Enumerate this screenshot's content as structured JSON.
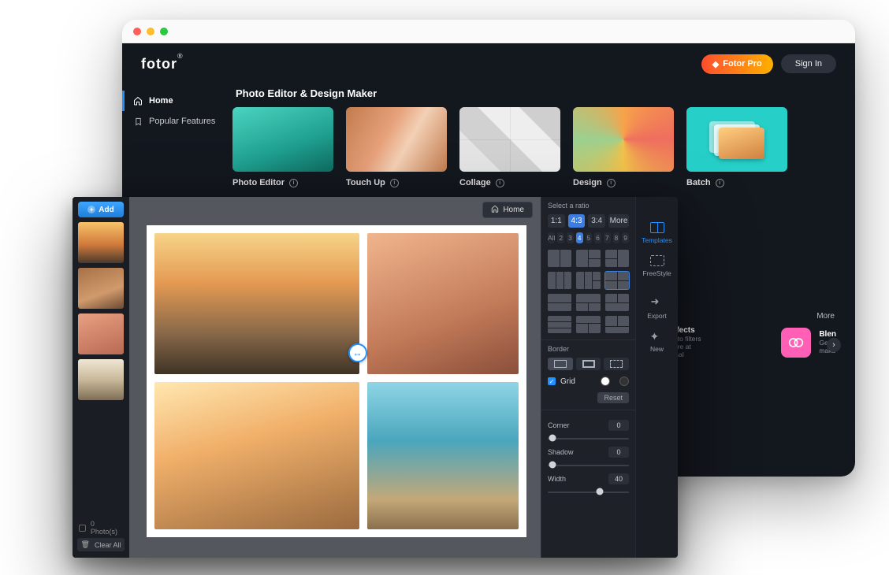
{
  "back": {
    "logo": "fotor",
    "pro_label": "Fotor Pro",
    "signin_label": "Sign In",
    "sidebar": {
      "items": [
        {
          "label": "Home"
        },
        {
          "label": "Popular Features"
        }
      ]
    },
    "section_title": "Photo Editor & Design Maker",
    "cards": [
      {
        "label": "Photo Editor"
      },
      {
        "label": "Touch Up"
      },
      {
        "label": "Collage"
      },
      {
        "label": "Design"
      },
      {
        "label": "Batch"
      }
    ],
    "more_label": "More",
    "peek": {
      "effects_title": "ffects",
      "effects_sub1": "oto filters are at",
      "effects_sub2": "isal",
      "blen_title": "Blen",
      "blen_sub1": "Get",
      "blen_sub2": "maku"
    }
  },
  "editor": {
    "add_label": "Add",
    "photos_count": "0 Photo(s)",
    "clear_all": "Clear All",
    "home_label": "Home",
    "ratio": {
      "label": "Select a ratio",
      "options": [
        "1:1",
        "4:3",
        "3:4",
        "More"
      ],
      "active": "4:3",
      "counts": [
        "All",
        "2",
        "3",
        "4",
        "5",
        "6",
        "7",
        "8",
        "9"
      ]
    },
    "border": {
      "label": "Border",
      "grid_label": "Grid",
      "reset_label": "Reset"
    },
    "sliders": {
      "corner": {
        "label": "Corner",
        "value": "0",
        "pos": 6
      },
      "shadow": {
        "label": "Shadow",
        "value": "0",
        "pos": 6
      },
      "width": {
        "label": "Width",
        "value": "40",
        "pos": 64
      }
    },
    "tools": {
      "templates": "Templates",
      "freestyle": "FreeStyle",
      "export": "Export",
      "new": "New"
    }
  }
}
